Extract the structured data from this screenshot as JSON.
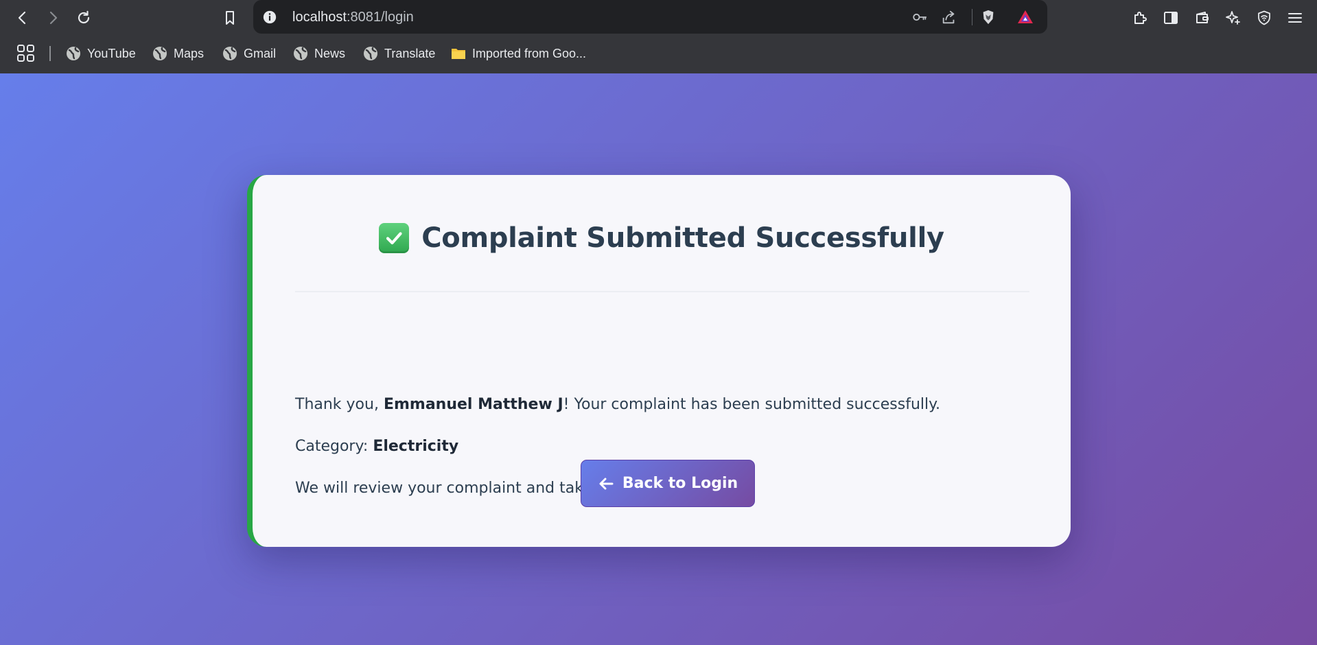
{
  "browser": {
    "url_host": "localhost",
    "url_rest": ":8081/login",
    "bookmarks": [
      {
        "label": "YouTube"
      },
      {
        "label": "Maps"
      },
      {
        "label": "Gmail"
      },
      {
        "label": "News"
      },
      {
        "label": "Translate"
      },
      {
        "label": "Imported from Goo..."
      }
    ]
  },
  "page": {
    "title": "Complaint Submitted Successfully",
    "thanks_prefix": "Thank you, ",
    "user_name": "Emmanuel Matthew J",
    "thanks_suffix": "! Your complaint has been submitted successfully.",
    "category_label": "Category: ",
    "category_value": "Electricity",
    "review_message": "We will review your complaint and take appropriate action.",
    "back_button_label": "Back to Login"
  },
  "colors": {
    "gradient_start": "#667eea",
    "gradient_end": "#764ba2",
    "success_accent": "#28a745",
    "heading_text": "#2c3e50"
  }
}
